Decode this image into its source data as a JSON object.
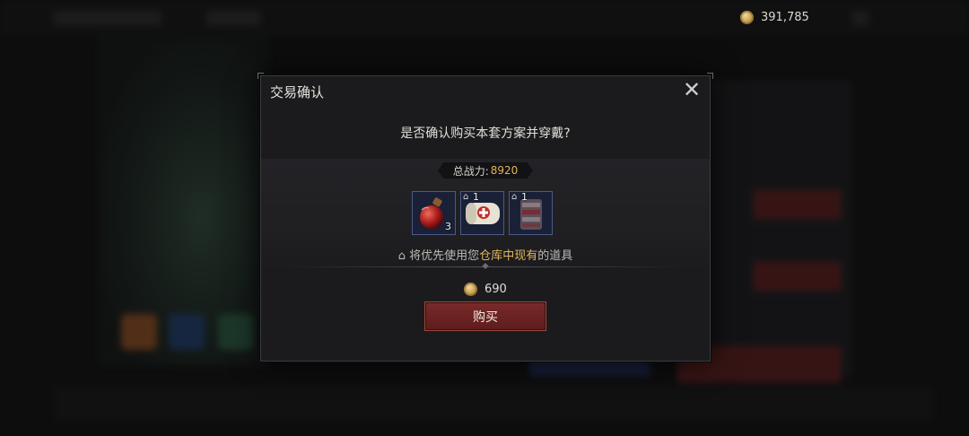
{
  "top_bar": {
    "gold_amount": "391,785",
    "coin_icon": "gold-coin-icon"
  },
  "dialog": {
    "title": "交易确认",
    "close_icon": "close-icon",
    "question": "是否确认购买本套方案并穿戴?",
    "power_label": "总战力:",
    "power_value": "8920",
    "items": [
      {
        "name": "red-potion-icon",
        "count": "3",
        "in_storage": false
      },
      {
        "name": "bandage-icon",
        "count": "1",
        "in_storage": true
      },
      {
        "name": "armor-scroll-icon",
        "count": "1",
        "in_storage": true
      }
    ],
    "priority_prefix": "将优先使用您",
    "priority_highlight": "仓库中现有",
    "priority_suffix": "的道具",
    "price": "690",
    "buy_label": "购买"
  },
  "colors": {
    "accent_gold": "#e2b45a",
    "buy_red": "#6e2424",
    "item_border": "#4b5a86"
  }
}
